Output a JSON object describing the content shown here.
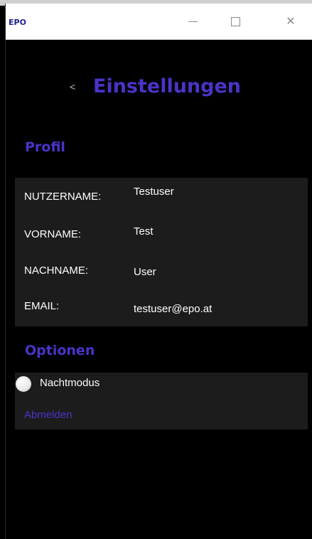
{
  "window": {
    "logo_text": "EPO",
    "controls": {
      "close_glyph": "✕"
    }
  },
  "header": {
    "back_glyph": "<",
    "title": "Einstellungen"
  },
  "profile": {
    "heading": "Profil",
    "rows": [
      {
        "label": "NUTZERNAME:",
        "value": "Testuser"
      },
      {
        "label": "VORNAME:",
        "value": "Test"
      },
      {
        "label": "NACHNAME:",
        "value": "User"
      },
      {
        "label": "EMAIL:",
        "value": "testuser@epo.at"
      }
    ]
  },
  "options": {
    "heading": "Optionen",
    "night_mode_label": "Nachtmodus",
    "logout_label": "Abmelden"
  },
  "colors": {
    "accent": "#4b33c8",
    "panel": "#1c1c1c",
    "background": "#000000"
  }
}
